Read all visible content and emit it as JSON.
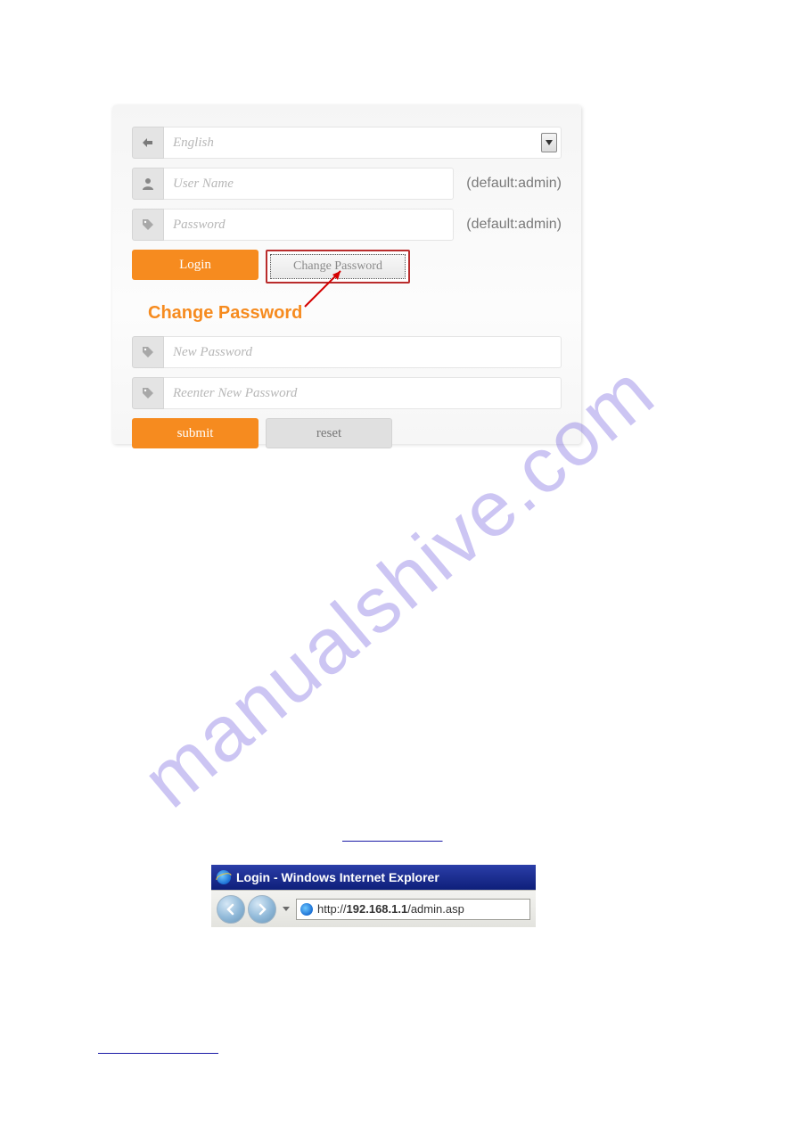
{
  "login_panel": {
    "language": {
      "value": "English"
    },
    "username": {
      "placeholder": "User Name",
      "hint": "(default:admin)"
    },
    "password": {
      "placeholder": "Password",
      "hint": "(default:admin)"
    },
    "login_label": "Login",
    "change_pw_label": "Change Password",
    "section_title": "Change Password",
    "new_pw": {
      "placeholder": "New Password"
    },
    "reenter_pw": {
      "placeholder": "Reenter New Password"
    },
    "submit_label": "submit",
    "reset_label": "reset"
  },
  "watermark": "manualshive.com",
  "admin_link_text": "",
  "ie_window": {
    "title": "Login - Windows Internet Explorer",
    "url_prefix": "http://",
    "url_host": "192.168.1.1",
    "url_path": "/admin.asp"
  },
  "bottom_link_text": ""
}
